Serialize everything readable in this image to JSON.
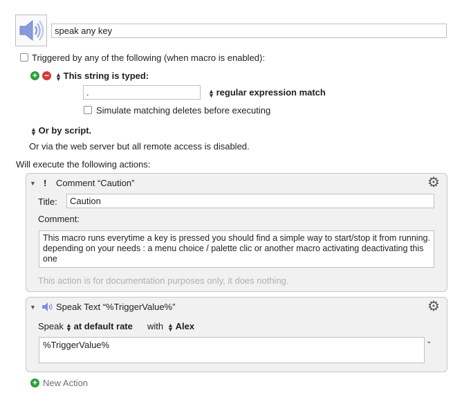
{
  "macro": {
    "name": "speak any key"
  },
  "trigger": {
    "header": "Triggered by any of the following (when macro is enabled):",
    "string_trigger_label": "This string is typed:",
    "typed_string": ".",
    "match_mode": "regular expression match",
    "simulate_label": "Simulate matching deletes before executing",
    "or_script_label": "Or by script.",
    "web_server_text": "Or via the web server but all remote access is disabled."
  },
  "actions_header": "Will execute the following actions:",
  "comment_action": {
    "header": "Comment “Caution”",
    "title_label": "Title:",
    "title_value": "Caution",
    "comment_label": "Comment:",
    "comment_text": "This macro runs everytime a key is pressed you should find a simple way to start/stop it from running. depending on your needs : a menu choice / palette clic or another macro activating deactivating this one",
    "footer": "This action is for documentation purposes only, it does nothing."
  },
  "speak_action": {
    "header": "Speak Text “%TriggerValue%”",
    "speak_label": "Speak",
    "rate_label": "at default rate",
    "with_label": "with",
    "voice": "Alex",
    "text": "%TriggerValue%"
  },
  "new_action_label": "New Action",
  "colors": {
    "add_green": "#2e9e3a",
    "remove_red": "#d63a3a",
    "speaker_blue": "#7b8fdc"
  }
}
